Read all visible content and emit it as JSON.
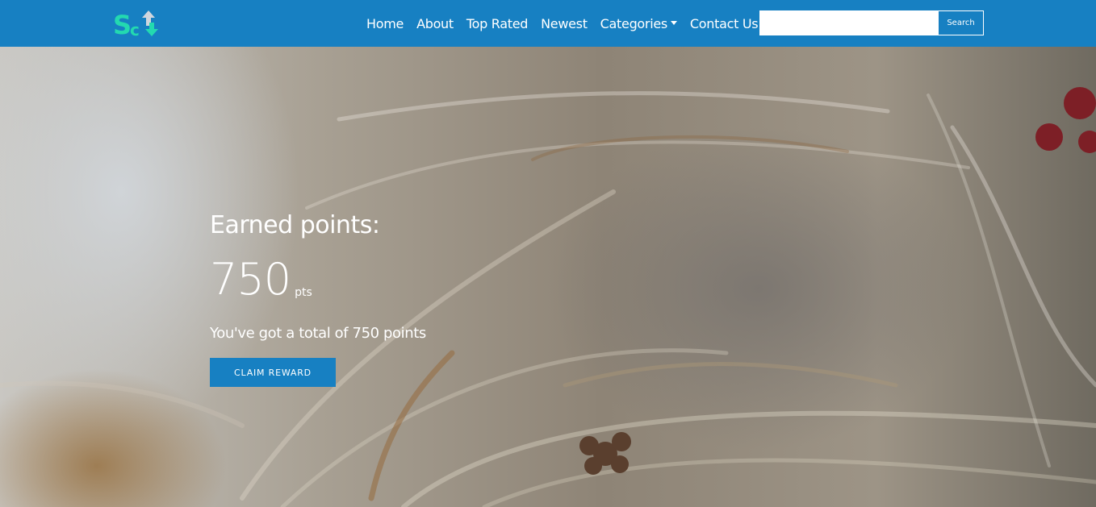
{
  "brand": {
    "logo_text": "SC",
    "logo_icon": "up-down-arrows-icon",
    "accent": "#23d9b0",
    "nav_color": "#1780c2"
  },
  "nav": {
    "items": [
      {
        "label": "Home"
      },
      {
        "label": "About"
      },
      {
        "label": "Top Rated"
      },
      {
        "label": "Newest"
      },
      {
        "label": "Categories"
      },
      {
        "label": "Contact Us"
      }
    ]
  },
  "search": {
    "placeholder": "",
    "value": "",
    "button_label": "Search"
  },
  "hero": {
    "title": "Earned points:",
    "points_value": "750",
    "points_unit": "pts",
    "summary": "You've got a total of 750 points",
    "cta_label": "CLAIM REWARD"
  }
}
